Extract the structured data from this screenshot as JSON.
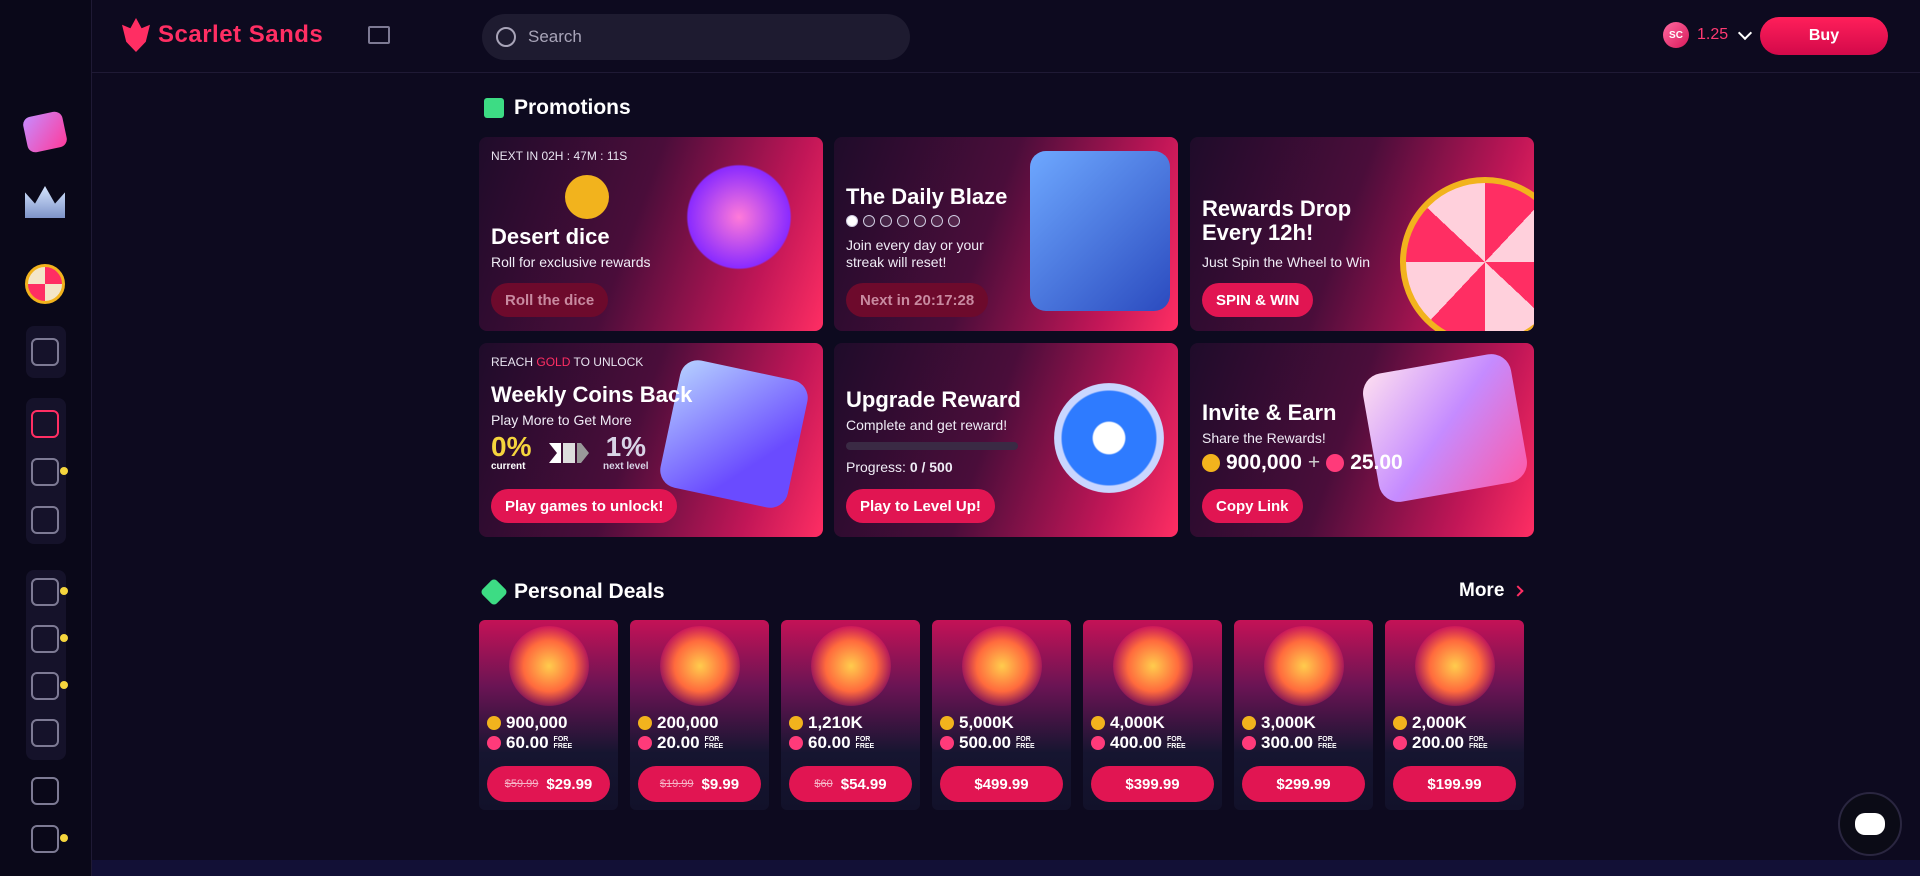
{
  "brand": {
    "name": "Scarlet Sands"
  },
  "search": {
    "placeholder": "Search"
  },
  "header": {
    "balance": "1.25",
    "currency_badge": "SC",
    "buy_label": "Buy"
  },
  "promotions": {
    "title": "Promotions",
    "cards": [
      {
        "eyebrow": "NEXT IN 02H : 47M : 11S",
        "title": "Desert dice",
        "subtitle": "Roll for exclusive rewards",
        "button": "Roll the dice"
      },
      {
        "title": "The Daily Blaze",
        "subtitle": "Join every day or your streak will reset!",
        "button": "Next in 20:17:28",
        "streak_days": 7,
        "streak_done": 1
      },
      {
        "title": "Rewards Drop Every 12h!",
        "subtitle": "Just Spin the Wheel to Win",
        "button": "SPIN & WIN"
      },
      {
        "eyebrow_pre": "REACH",
        "eyebrow_highlight": "GOLD",
        "eyebrow_post": "TO UNLOCK",
        "title": "Weekly Coins Back",
        "subtitle": "Play More to Get More",
        "current_value": "0%",
        "current_label": "current",
        "next_value": "1%",
        "next_label": "next level",
        "button": "Play games to unlock!"
      },
      {
        "title": "Upgrade Reward",
        "subtitle": "Complete and get reward!",
        "progress_label": "Progress:",
        "progress_value": "0 / 500",
        "progress_fraction": 0,
        "button": "Play to Level Up!"
      },
      {
        "title": "Invite & Earn",
        "subtitle": "Share the Rewards!",
        "coins": "900,000",
        "plus": "+",
        "gems": "25.00",
        "button": "Copy Link"
      }
    ]
  },
  "deals": {
    "title": "Personal Deals",
    "more_label": "More",
    "free_label": "FOR FREE",
    "items": [
      {
        "coins": "900,000",
        "gems": "60.00",
        "old_price": "$59.99",
        "price": "$29.99"
      },
      {
        "coins": "200,000",
        "gems": "20.00",
        "old_price": "$19.99",
        "price": "$9.99"
      },
      {
        "coins": "1,210K",
        "gems": "60.00",
        "old_price": "$60",
        "price": "$54.99"
      },
      {
        "coins": "5,000K",
        "gems": "500.00",
        "old_price": "",
        "price": "$499.99"
      },
      {
        "coins": "4,000K",
        "gems": "400.00",
        "old_price": "",
        "price": "$399.99"
      },
      {
        "coins": "3,000K",
        "gems": "300.00",
        "old_price": "",
        "price": "$299.99"
      },
      {
        "coins": "2,000K",
        "gems": "200.00",
        "old_price": "",
        "price": "$199.99"
      }
    ]
  },
  "colors": {
    "accent": "#ff2e63",
    "background": "#0d0a1f",
    "gold": "#f5d53d",
    "positive": "#3ddc84"
  }
}
